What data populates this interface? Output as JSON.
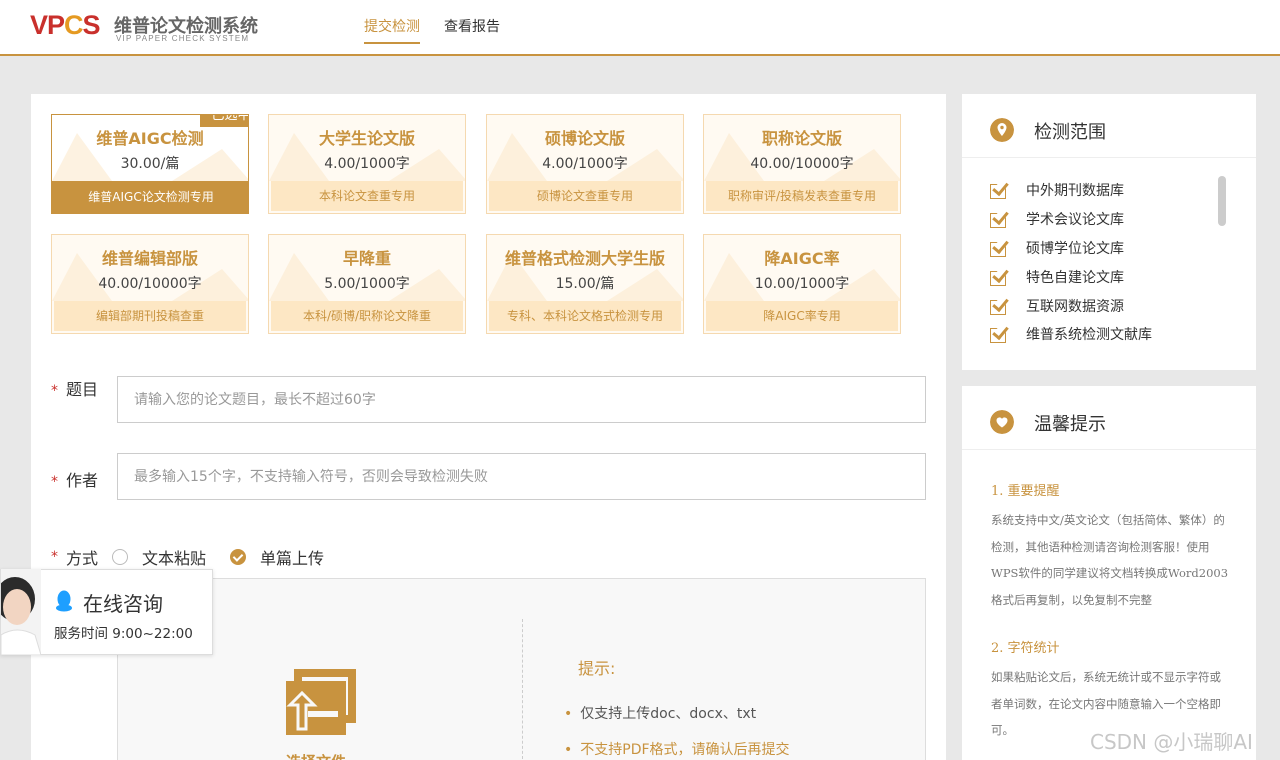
{
  "header": {
    "logo_mark": [
      "V",
      "P",
      "C",
      "S"
    ],
    "logo_cn": "维普论文检测系统",
    "logo_en": "VIP PAPER CHECK SYSTEM",
    "nav": [
      {
        "label": "提交检测",
        "active": true
      },
      {
        "label": "查看报告",
        "active": false
      }
    ]
  },
  "products": [
    {
      "title": "维普AIGC检测",
      "price": "30.00/篇",
      "desc": "维普AIGC论文检测专用",
      "selected": true
    },
    {
      "title": "大学生论文版",
      "price": "4.00/1000字",
      "desc": "本科论文查重专用",
      "selected": false
    },
    {
      "title": "硕博论文版",
      "price": "4.00/1000字",
      "desc": "硕博论文查重专用",
      "selected": false
    },
    {
      "title": "职称论文版",
      "price": "40.00/10000字",
      "desc": "职称审评/投稿发表查重专用",
      "selected": false
    },
    {
      "title": "维普编辑部版",
      "price": "40.00/10000字",
      "desc": "编辑部期刊投稿查重",
      "selected": false
    },
    {
      "title": "早降重",
      "price": "5.00/1000字",
      "desc": "本科/硕博/职称论文降重",
      "selected": false
    },
    {
      "title": "维普格式检测大学生版",
      "price": "15.00/篇",
      "desc": "专科、本科论文格式检测专用",
      "selected": false
    },
    {
      "title": "降AIGC率",
      "price": "10.00/1000字",
      "desc": "降AIGC率专用",
      "selected": false
    }
  ],
  "selected_badge": "已选中",
  "form": {
    "required_mark": "*",
    "title_label": "题目",
    "title_placeholder": "请输入您的论文题目，最长不超过60字",
    "author_label": "作者",
    "author_placeholder": "最多输入15个字，不支持输入符号，否则会导致检测失败",
    "method_label": "方式",
    "method_options": [
      {
        "label": "文本粘贴",
        "selected": false
      },
      {
        "label": "单篇上传",
        "selected": true
      }
    ]
  },
  "upload": {
    "button_label": "选择文件",
    "tip_title": "提示:",
    "tips": [
      {
        "text": "仅支持上传doc、docx、txt",
        "warn": false
      },
      {
        "text": "不支持PDF格式，请确认后再提交",
        "warn": true
      }
    ]
  },
  "scope": {
    "title": "检测范围",
    "items": [
      "中外期刊数据库",
      "学术会议论文库",
      "硕博学位论文库",
      "特色自建论文库",
      "互联网数据资源",
      "维普系统检测文献库"
    ]
  },
  "hints": {
    "title": "温馨提示",
    "sections": [
      {
        "heading": "1. 重要提醒",
        "body": "系统支持中文/英文论文（包括简体、繁体）的检测，其他语种检测请咨询检测客服！使用WPS软件的同学建议将文档转换成Word2003格式后再复制，以免复制不完整"
      },
      {
        "heading": "2. 字符统计",
        "body": "如果粘贴论文后，系统无统计或不显示字符或者单词数，在论文内容中随意输入一个空格即可。"
      }
    ]
  },
  "consult": {
    "title": "在线咨询",
    "hours": "服务时间 9:00~22:00"
  },
  "watermark": "CSDN @小瑞聊AI",
  "colors": {
    "accent": "#c8933f",
    "required": "#c9302c",
    "card_bg": "#fffaf2",
    "card_foot": "#fde7c4"
  }
}
